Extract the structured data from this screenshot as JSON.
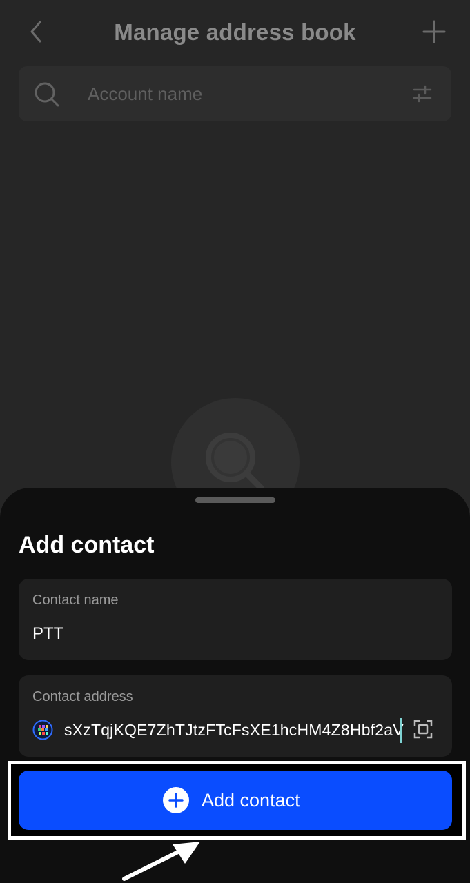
{
  "header": {
    "title": "Manage address book"
  },
  "search": {
    "placeholder": "Account name"
  },
  "sheet": {
    "title": "Add contact",
    "contact_name": {
      "label": "Contact name",
      "value": "PTT"
    },
    "contact_address": {
      "label": "Contact address",
      "value": "sXzTqjKQE7ZhTJtzFTcFsXE1hcHM4Z8Hbf2aV"
    },
    "button_label": "Add contact"
  },
  "colors": {
    "accent": "#0a4dff",
    "sheet": "#0f0f0f",
    "background": "#262626"
  }
}
